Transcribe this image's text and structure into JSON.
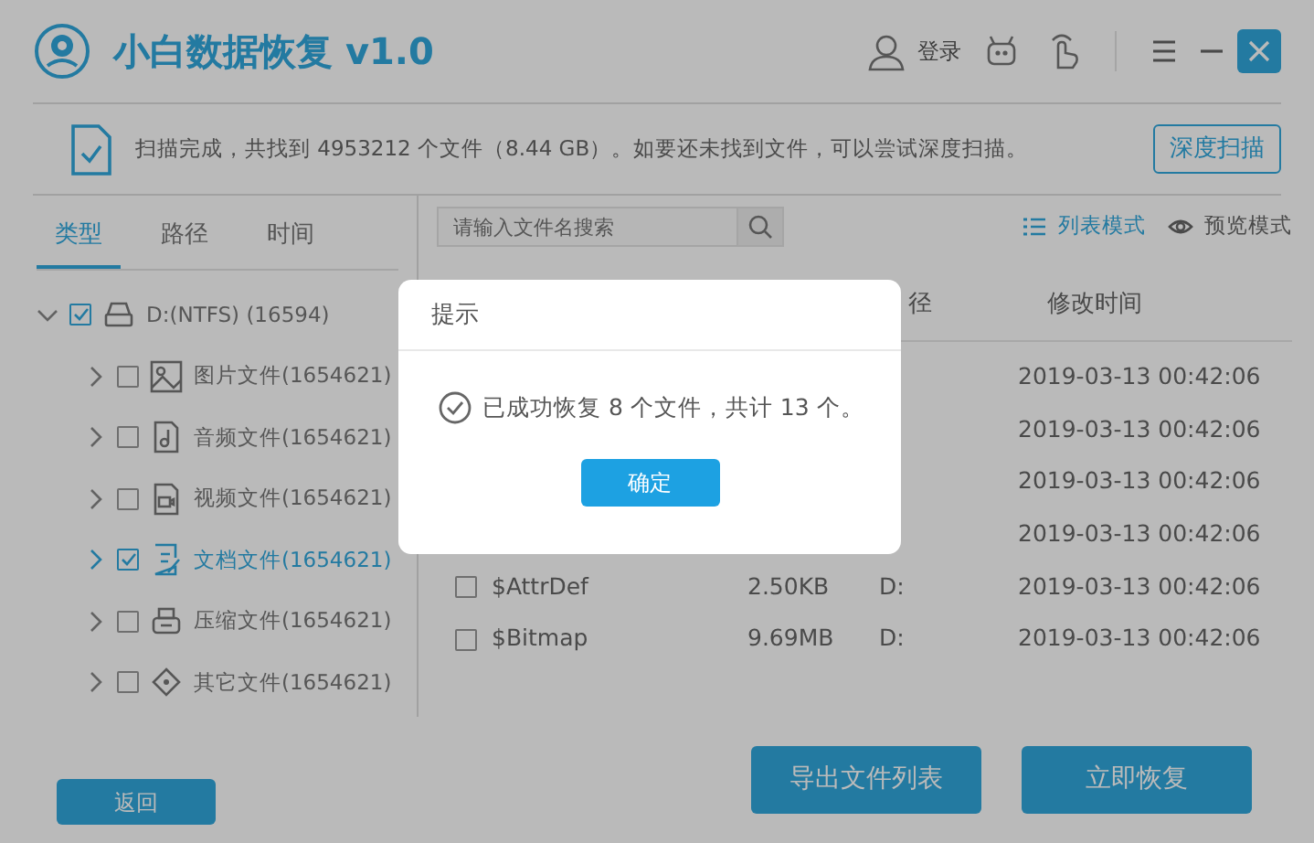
{
  "window": {
    "title": "小白数据恢复 v1.0",
    "login": "登录"
  },
  "scan_notice": {
    "message": "扫描完成，共找到 4953212 个文件（8.44 GB）。如要还未找到文件，可以尝试深度扫描。",
    "deep_scan_button": "深度扫描"
  },
  "tabs": [
    {
      "label": "类型",
      "selected": true
    },
    {
      "label": "路径",
      "selected": false
    },
    {
      "label": "时间",
      "selected": false
    }
  ],
  "tree": {
    "label": "D:(NTFS) (16594)",
    "checked": true,
    "expanded": true,
    "children": [
      {
        "label": "图片文件(1654621)",
        "kind": "image",
        "checked": false,
        "selected": false,
        "expanded": false
      },
      {
        "label": "音频文件(1654621)",
        "kind": "audio",
        "checked": false,
        "selected": false,
        "expanded": false
      },
      {
        "label": "视频文件(1654621)",
        "kind": "video",
        "checked": false,
        "selected": false,
        "expanded": false
      },
      {
        "label": "文档文件(1654621)",
        "kind": "document",
        "checked": true,
        "selected": true,
        "expanded": false
      },
      {
        "label": "压缩文件(1654621)",
        "kind": "archive",
        "checked": false,
        "selected": false,
        "expanded": false
      },
      {
        "label": "其它文件(1654621)",
        "kind": "other",
        "checked": false,
        "selected": false,
        "expanded": false
      }
    ]
  },
  "search": {
    "placeholder": "请输入文件名搜索"
  },
  "view_modes": [
    {
      "label": "列表模式",
      "kind": "list",
      "selected": true
    },
    {
      "label": "预览模式",
      "kind": "preview",
      "selected": false
    }
  ],
  "table": {
    "columns": [
      "径",
      "修改时间"
    ],
    "rows": [
      {
        "modified": "2019-03-13 00:42:06"
      },
      {
        "modified": "2019-03-13 00:42:06"
      },
      {
        "modified": "2019-03-13 00:42:06"
      },
      {
        "modified": "2019-03-13 00:42:06"
      },
      {
        "checked": false,
        "name": "$AttrDef",
        "size": "2.50KB",
        "path": "D:",
        "modified": "2019-03-13 00:42:06"
      },
      {
        "checked": false,
        "name": "$Bitmap",
        "size": "9.69MB",
        "path": "D:",
        "modified": "2019-03-13 00:42:06"
      }
    ]
  },
  "dialog": {
    "title": "提示",
    "message": "已成功恢复 8 个文件，共计 13 个。",
    "ok_button": "确定"
  },
  "buttons": {
    "back": "返回",
    "export": "导出文件列表",
    "recover": "立即恢复"
  }
}
